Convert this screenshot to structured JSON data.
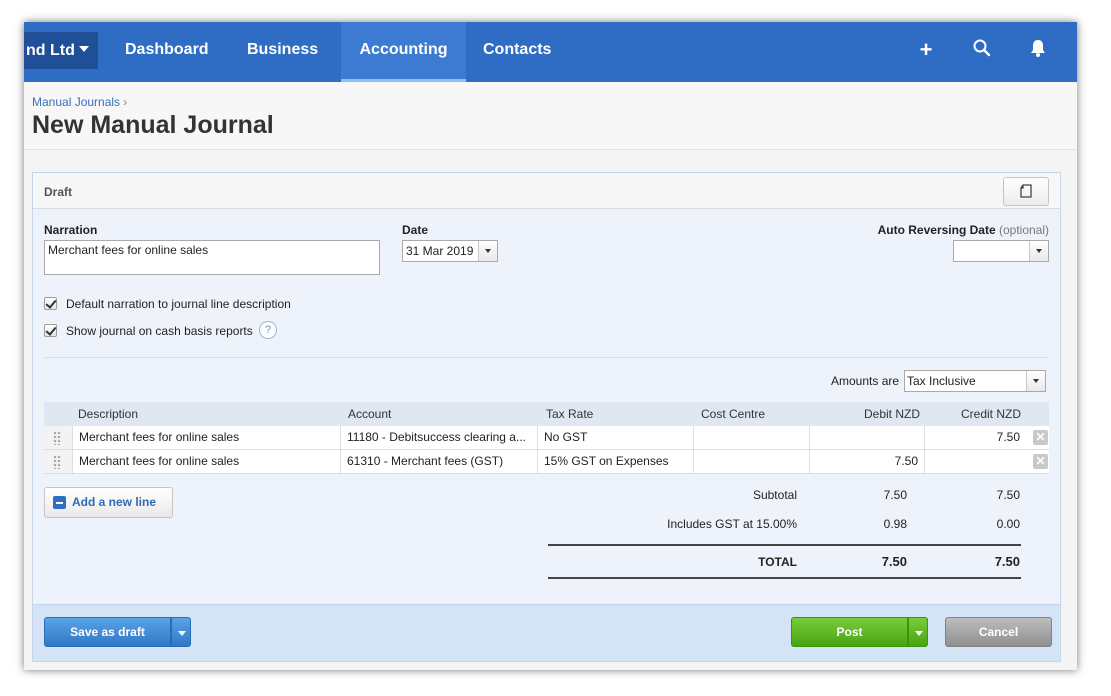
{
  "nav": {
    "org_name": "nd Ltd",
    "items": [
      "Dashboard",
      "Business",
      "Accounting",
      "Contacts"
    ],
    "active": "Accounting",
    "icons": [
      "plus-icon",
      "search-icon",
      "bell-icon"
    ]
  },
  "header": {
    "breadcrumb": "Manual Journals",
    "breadcrumb_sep": "›",
    "title": "New Manual Journal"
  },
  "draft": {
    "status": "Draft",
    "narration_label": "Narration",
    "narration_value": "Merchant fees for online sales",
    "date_label": "Date",
    "date_value": "31 Mar 2019",
    "auto_reversing_label": "Auto Reversing Date",
    "auto_reversing_optional": "(optional)",
    "auto_reversing_value": "",
    "default_narration_label": "Default narration to journal line description",
    "default_narration_checked": true,
    "cash_basis_label": "Show journal on cash basis reports",
    "cash_basis_checked": true,
    "help_glyph": "?"
  },
  "amounts": {
    "label": "Amounts are",
    "value": "Tax Inclusive"
  },
  "table": {
    "headers": [
      "Description",
      "Account",
      "Tax Rate",
      "Cost Centre",
      "Debit NZD",
      "Credit NZD"
    ],
    "rows": [
      {
        "description": "Merchant fees for online sales",
        "account": "11180 - Debitsuccess clearing a...",
        "tax_rate": "No GST",
        "cost_centre": "",
        "debit": "",
        "credit": "7.50"
      },
      {
        "description": "Merchant fees for online sales",
        "account": "61310 - Merchant fees (GST)",
        "tax_rate": "15% GST on Expenses",
        "cost_centre": "",
        "debit": "7.50",
        "credit": ""
      }
    ],
    "delete_glyph": "✕"
  },
  "add_line_label": "Add a new line",
  "totals": {
    "subtotal_label": "Subtotal",
    "subtotal_debit": "7.50",
    "subtotal_credit": "7.50",
    "gst_label": "Includes GST at 15.00%",
    "gst_debit": "0.98",
    "gst_credit": "0.00",
    "total_label": "TOTAL",
    "total_debit": "7.50",
    "total_credit": "7.50"
  },
  "footer": {
    "save_draft_label": "Save as draft",
    "post_label": "Post",
    "cancel_label": "Cancel"
  },
  "colors": {
    "nav_bg": "#2f6cc4",
    "post_green": "#52b11a",
    "save_blue": "#3a86d4"
  }
}
